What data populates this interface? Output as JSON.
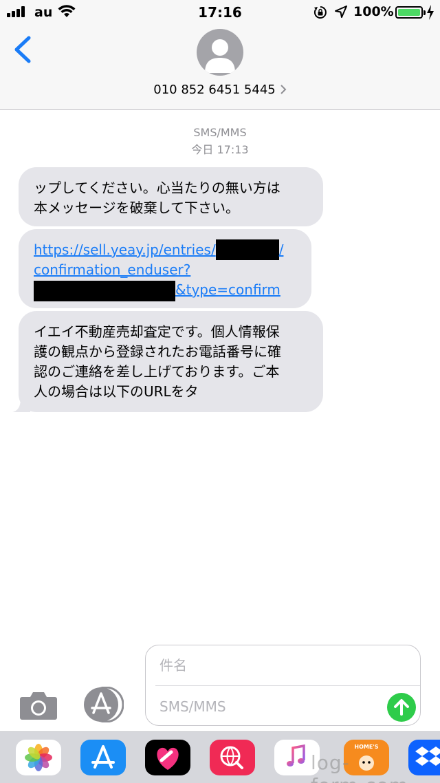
{
  "status_bar": {
    "carrier": "au",
    "time": "17:16",
    "battery_percent": "100%",
    "battery_level": 1.0
  },
  "header": {
    "contact_number": "010 852 6451 5445"
  },
  "conversation": {
    "service": "SMS/MMS",
    "timestamp": "今日 17:13",
    "messages": [
      {
        "line1": "ップしてください。心当たりの無い方は",
        "line2": "本メッセージを破棄して下さい。"
      },
      {
        "link_part1": "https://sell.yeay.jp/entries/",
        "link_part2": "/",
        "link_part3": "confirmation_enduser?",
        "link_part4": "&type=confirm"
      },
      {
        "line1": "イエイ不動産売却査定です。個人情報保",
        "line2": "護の観点から登録されたお電話番号に確",
        "line3": "認のご連絡を差し上げております。ご本",
        "line4": "人の場合は以下のURLをタ"
      }
    ]
  },
  "compose": {
    "subject_placeholder": "件名",
    "message_placeholder": "SMS/MMS"
  },
  "app_drawer": {
    "homes_label": "HOME'S"
  },
  "watermark": "log-form.com",
  "colors": {
    "bubble": "#e5e5ea",
    "link": "#1a7cf7",
    "send": "#2ecc4a",
    "ios_blue": "#1a7cf7"
  }
}
